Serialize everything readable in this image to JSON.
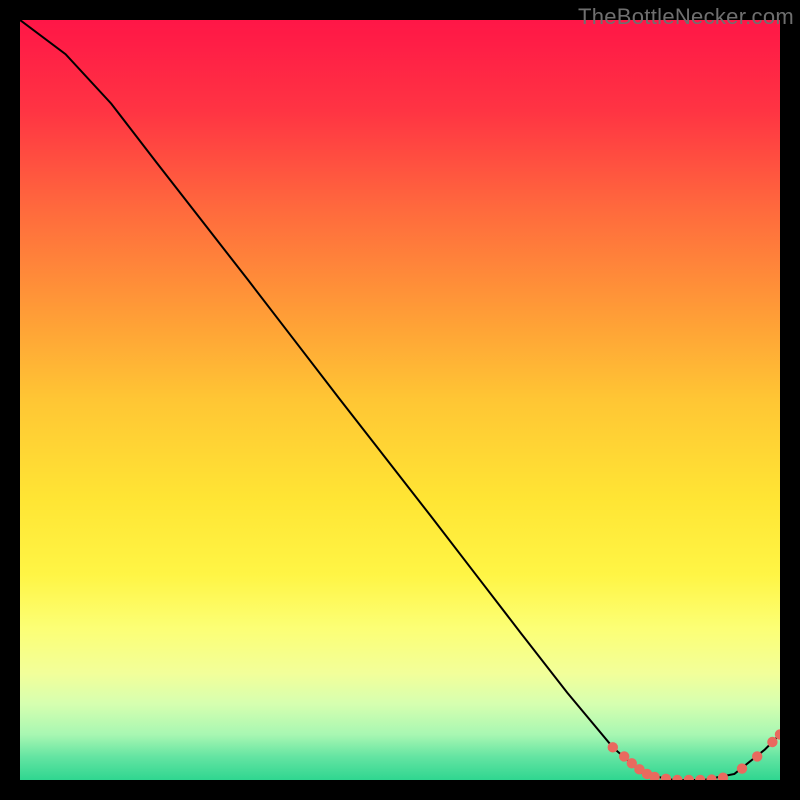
{
  "watermark": "TheBottleNecker.com",
  "chart_data": {
    "type": "line",
    "xlabel": "",
    "ylabel": "",
    "xlim": [
      0,
      100
    ],
    "ylim": [
      0,
      100
    ],
    "series": [
      {
        "name": "curve",
        "x": [
          0,
          6,
          12,
          18,
          24,
          30,
          36,
          42,
          48,
          54,
          60,
          66,
          72,
          78,
          82,
          86,
          90,
          94,
          98,
          100
        ],
        "y": [
          100,
          95.5,
          89,
          81.2,
          73.5,
          65.8,
          58,
          50.2,
          42.5,
          34.8,
          27,
          19.2,
          11.5,
          4.3,
          0.8,
          0.0,
          0.0,
          0.8,
          4.0,
          6.0
        ]
      }
    ],
    "markers": [
      {
        "x": 78.0,
        "y": 4.3
      },
      {
        "x": 79.5,
        "y": 3.1
      },
      {
        "x": 80.5,
        "y": 2.2
      },
      {
        "x": 81.5,
        "y": 1.4
      },
      {
        "x": 82.5,
        "y": 0.8
      },
      {
        "x": 83.5,
        "y": 0.4
      },
      {
        "x": 85.0,
        "y": 0.15
      },
      {
        "x": 86.5,
        "y": 0.0
      },
      {
        "x": 88.0,
        "y": 0.0
      },
      {
        "x": 89.5,
        "y": 0.0
      },
      {
        "x": 91.0,
        "y": 0.05
      },
      {
        "x": 92.5,
        "y": 0.3
      },
      {
        "x": 95.0,
        "y": 1.5
      },
      {
        "x": 97.0,
        "y": 3.1
      },
      {
        "x": 99.0,
        "y": 5.0
      },
      {
        "x": 100.0,
        "y": 6.0
      }
    ],
    "gradient_stops": [
      {
        "pct": 0.0,
        "color": "#ff1647"
      },
      {
        "pct": 0.12,
        "color": "#ff3443"
      },
      {
        "pct": 0.25,
        "color": "#ff6a3d"
      },
      {
        "pct": 0.38,
        "color": "#ff9a37"
      },
      {
        "pct": 0.5,
        "color": "#ffc634"
      },
      {
        "pct": 0.63,
        "color": "#ffe534"
      },
      {
        "pct": 0.73,
        "color": "#fff545"
      },
      {
        "pct": 0.8,
        "color": "#fcff75"
      },
      {
        "pct": 0.86,
        "color": "#f2ff9a"
      },
      {
        "pct": 0.9,
        "color": "#d6ffb0"
      },
      {
        "pct": 0.94,
        "color": "#a8f7b2"
      },
      {
        "pct": 0.97,
        "color": "#63e4a2"
      },
      {
        "pct": 1.0,
        "color": "#2fd690"
      }
    ],
    "marker_color": "#e96a5e",
    "curve_color": "#000000"
  }
}
